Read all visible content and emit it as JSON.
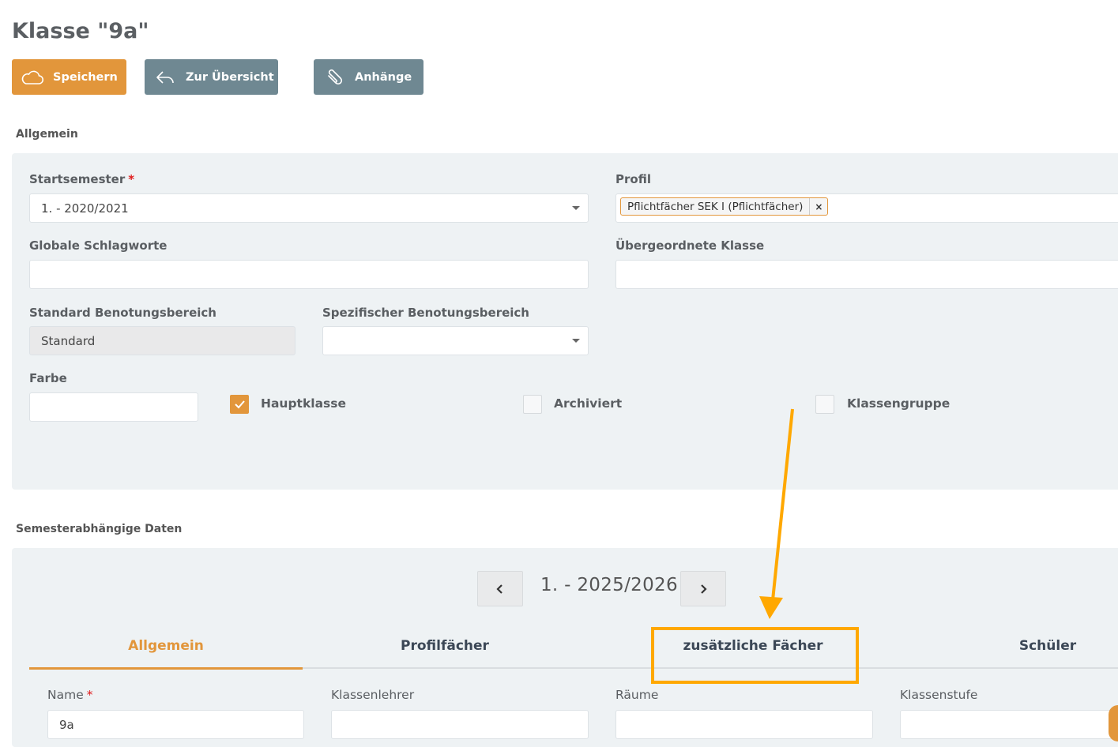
{
  "page": {
    "title": "Klasse \"9a\""
  },
  "toolbar": {
    "save_label": "Speichern",
    "back_label": "Zur Übersicht",
    "attachments_label": "Anhänge"
  },
  "general": {
    "section_label": "Allgemein",
    "startsemester": {
      "label": "Startsemester",
      "required": "*",
      "value": "1. - 2020/2021"
    },
    "profil": {
      "label": "Profil",
      "tag": "Pflichtfächer SEK I (Pflichtfächer)",
      "tag_remove": "×"
    },
    "schlagworte": {
      "label": "Globale Schlagworte",
      "value": ""
    },
    "uebergeordnet": {
      "label": "Übergeordnete Klasse",
      "value": ""
    },
    "standard_benotung": {
      "label": "Standard Benotungsbereich",
      "value": "Standard"
    },
    "spezifisch_benotung": {
      "label": "Spezifischer Benotungsbereich",
      "value": ""
    },
    "farbe": {
      "label": "Farbe",
      "value": ""
    },
    "checkboxes": [
      {
        "label": "Hauptklasse",
        "checked": true
      },
      {
        "label": "Archiviert",
        "checked": false
      },
      {
        "label": "Klassengruppe",
        "checked": false
      }
    ]
  },
  "semester": {
    "section_label": "Semesterabhängige Daten",
    "current": "1. - 2025/2026",
    "tabs": [
      {
        "label": "Allgemein",
        "active": true
      },
      {
        "label": "Profilfächer",
        "active": false
      },
      {
        "label": "zusätzliche Fächer",
        "active": false
      },
      {
        "label": "Schüler",
        "active": false
      }
    ],
    "fields": {
      "name": {
        "label": "Name",
        "required": "*",
        "value": "9a"
      },
      "klassenlehrer": {
        "label": "Klassenlehrer",
        "value": ""
      },
      "raeume": {
        "label": "Räume",
        "value": ""
      },
      "klassenstufe": {
        "label": "Klassenstufe",
        "value": ""
      }
    }
  },
  "colors": {
    "accent": "#e2963b",
    "secondary": "#6f8892",
    "annotation": "#ffa800"
  }
}
